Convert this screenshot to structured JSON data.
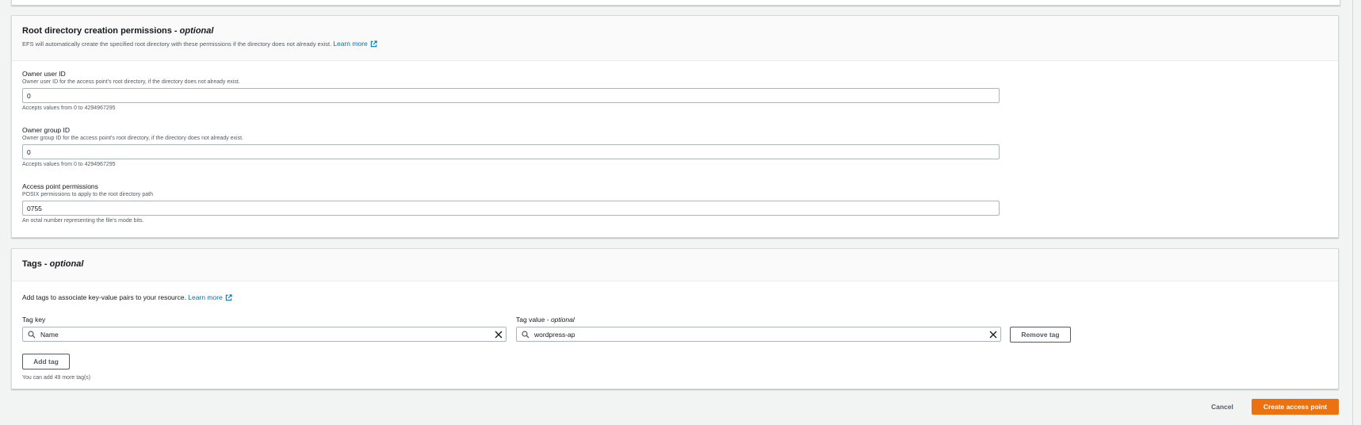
{
  "root_dir": {
    "title": "Root directory creation permissions - ",
    "title_optional": "optional",
    "description": "EFS will automatically create the specified root directory with these permissions if the directory does not already exist.",
    "learn_more": "Learn more",
    "owner_uid": {
      "label": "Owner user ID",
      "description": "Owner user ID for the access point's root directory, if the directory does not already exist.",
      "value": "0",
      "hint": "Accepts values from 0 to 4294967295"
    },
    "owner_gid": {
      "label": "Owner group ID",
      "description": "Owner group ID for the access point's root directory, if the directory does not already exist.",
      "value": "0",
      "hint": "Accepts values from 0 to 4294967295"
    },
    "permissions": {
      "label": "Access point permissions",
      "description": "POSIX permissions to apply to the root directory path",
      "value": "0755",
      "hint": "An octal number representing the file's mode bits."
    }
  },
  "tags": {
    "title": "Tags - ",
    "title_optional": "optional",
    "description": "Add tags to associate key-value pairs to your resource.",
    "learn_more": "Learn more",
    "key_label": "Tag key",
    "value_label": "Tag value - ",
    "value_label_optional": "optional",
    "rows": [
      {
        "key": "Name",
        "value": "wordpress-ap"
      }
    ],
    "remove_label": "Remove tag",
    "add_label": "Add tag",
    "remaining": "You can add 49 more tag(s)"
  },
  "actions": {
    "cancel": "Cancel",
    "create": "Create access point"
  },
  "colors": {
    "primary": "#ec7211",
    "link": "#0073bb",
    "border": "#aab7b8"
  }
}
